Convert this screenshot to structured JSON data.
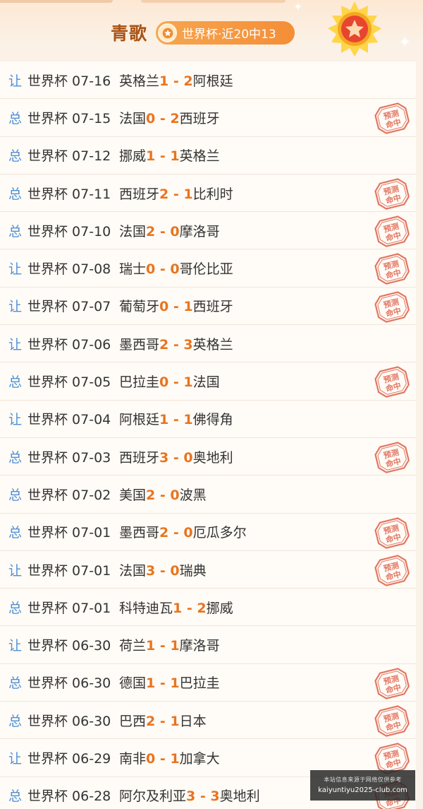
{
  "header": {
    "title": "青歌",
    "badge": "世界杯·近20中13"
  },
  "stamp_text": "预测命中",
  "colors": {
    "accent": "#e8741f",
    "type_blue": "#4e8fd6",
    "title_brown": "#a85314"
  },
  "rows": [
    {
      "type": "让",
      "league": "世界杯 07-16",
      "home": "英格兰",
      "score": "1 - 2",
      "away": "阿根廷",
      "hit": false
    },
    {
      "type": "总",
      "league": "世界杯 07-15",
      "home": "法国",
      "score": "0 - 2",
      "away": "西班牙",
      "hit": true
    },
    {
      "type": "总",
      "league": "世界杯 07-12",
      "home": "挪威",
      "score": "1 - 1",
      "away": "英格兰",
      "hit": false
    },
    {
      "type": "总",
      "league": "世界杯 07-11",
      "home": "西班牙",
      "score": "2 - 1",
      "away": "比利时",
      "hit": true
    },
    {
      "type": "总",
      "league": "世界杯 07-10",
      "home": "法国",
      "score": "2 - 0",
      "away": "摩洛哥",
      "hit": true
    },
    {
      "type": "让",
      "league": "世界杯 07-08",
      "home": "瑞士",
      "score": "0 - 0",
      "away": "哥伦比亚",
      "hit": true
    },
    {
      "type": "让",
      "league": "世界杯 07-07",
      "home": "葡萄牙",
      "score": "0 - 1",
      "away": "西班牙",
      "hit": true
    },
    {
      "type": "让",
      "league": "世界杯 07-06",
      "home": "墨西哥",
      "score": "2 - 3",
      "away": "英格兰",
      "hit": false
    },
    {
      "type": "总",
      "league": "世界杯 07-05",
      "home": "巴拉圭",
      "score": "0 - 1",
      "away": "法国",
      "hit": true
    },
    {
      "type": "让",
      "league": "世界杯 07-04",
      "home": "阿根廷",
      "score": "1 - 1",
      "away": "佛得角",
      "hit": false
    },
    {
      "type": "总",
      "league": "世界杯 07-03",
      "home": "西班牙",
      "score": "3 - 0",
      "away": "奥地利",
      "hit": true
    },
    {
      "type": "总",
      "league": "世界杯 07-02",
      "home": "美国",
      "score": "2 - 0",
      "away": "波黑",
      "hit": false
    },
    {
      "type": "总",
      "league": "世界杯 07-01",
      "home": "墨西哥",
      "score": "2 - 0",
      "away": "厄瓜多尔",
      "hit": true
    },
    {
      "type": "让",
      "league": "世界杯 07-01",
      "home": "法国",
      "score": "3 - 0",
      "away": "瑞典",
      "hit": true
    },
    {
      "type": "总",
      "league": "世界杯 07-01",
      "home": "科特迪瓦",
      "score": "1 - 2",
      "away": "挪威",
      "hit": false
    },
    {
      "type": "让",
      "league": "世界杯 06-30",
      "home": "荷兰",
      "score": "1 - 1",
      "away": "摩洛哥",
      "hit": false
    },
    {
      "type": "总",
      "league": "世界杯 06-30",
      "home": "德国",
      "score": "1 - 1",
      "away": "巴拉圭",
      "hit": true
    },
    {
      "type": "总",
      "league": "世界杯 06-30",
      "home": "巴西",
      "score": "2 - 1",
      "away": "日本",
      "hit": true
    },
    {
      "type": "让",
      "league": "世界杯 06-29",
      "home": "南非",
      "score": "0 - 1",
      "away": "加拿大",
      "hit": true
    },
    {
      "type": "总",
      "league": "世界杯 06-28",
      "home": "阿尔及利亚",
      "score": "3 - 3",
      "away": "奥地利",
      "hit": true
    }
  ],
  "watermark": {
    "line1": "本站信息来源于网络仅供参考",
    "line2": "kaiyuntiyu2025-club.com"
  }
}
